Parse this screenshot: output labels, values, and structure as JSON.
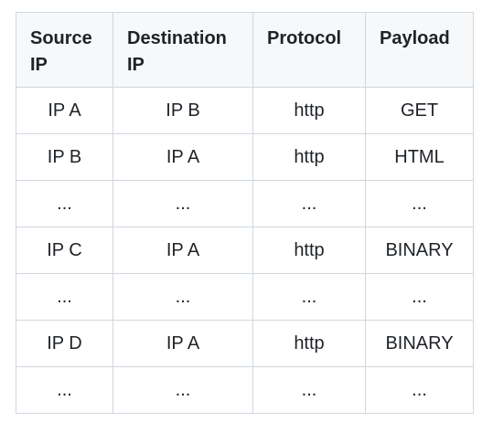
{
  "table": {
    "headers": [
      "Source IP",
      "Destination IP",
      "Protocol",
      "Payload"
    ],
    "rows": [
      [
        "IP A",
        "IP B",
        "http",
        "GET"
      ],
      [
        "IP B",
        "IP A",
        "http",
        "HTML"
      ],
      [
        "...",
        "...",
        "...",
        "..."
      ],
      [
        "IP C",
        "IP A",
        "http",
        "BINARY"
      ],
      [
        "...",
        "...",
        "...",
        "..."
      ],
      [
        "IP D",
        "IP A",
        "http",
        "BINARY"
      ],
      [
        "...",
        "...",
        "...",
        "..."
      ]
    ]
  }
}
